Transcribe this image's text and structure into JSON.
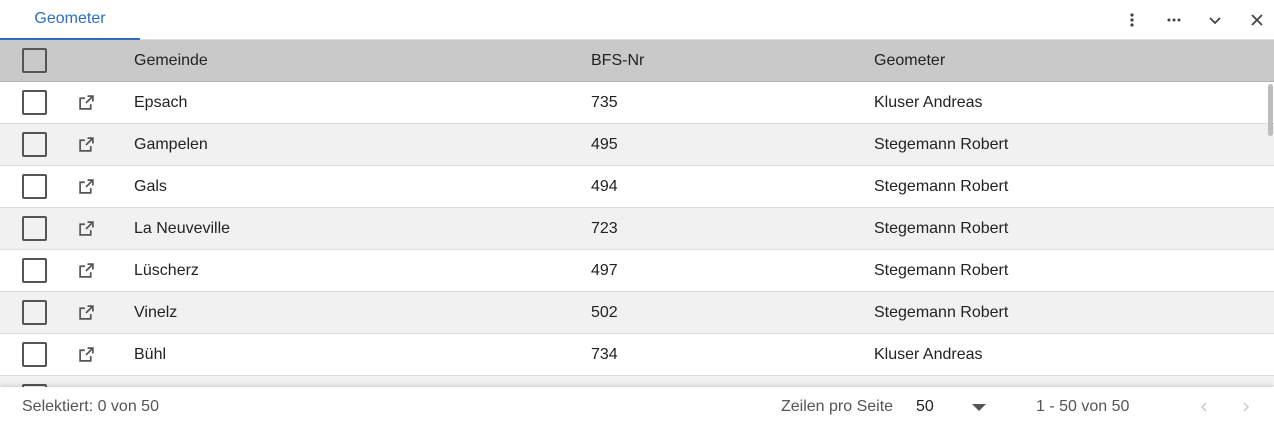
{
  "tab": {
    "label": "Geometer"
  },
  "toolbar": {
    "icons": [
      "more-vertical-icon",
      "more-horizontal-icon",
      "chevron-down-icon",
      "close-icon"
    ]
  },
  "table": {
    "columns": {
      "gemeinde": "Gemeinde",
      "bfs": "BFS-Nr",
      "geometer": "Geometer"
    },
    "rows": [
      {
        "gemeinde": "Epsach",
        "bfs": "735",
        "geometer": "Kluser Andreas"
      },
      {
        "gemeinde": "Gampelen",
        "bfs": "495",
        "geometer": "Stegemann Robert"
      },
      {
        "gemeinde": "Gals",
        "bfs": "494",
        "geometer": "Stegemann Robert"
      },
      {
        "gemeinde": "La Neuveville",
        "bfs": "723",
        "geometer": "Stegemann Robert"
      },
      {
        "gemeinde": "Lüscherz",
        "bfs": "497",
        "geometer": "Stegemann Robert"
      },
      {
        "gemeinde": "Vinelz",
        "bfs": "502",
        "geometer": "Stegemann Robert"
      },
      {
        "gemeinde": "Bühl",
        "bfs": "734",
        "geometer": "Kluser Andreas"
      }
    ]
  },
  "footer": {
    "selected": "Selektiert: 0 von 50",
    "rows_per_page_label": "Zeilen pro Seite",
    "rows_per_page_value": "50",
    "range": "1 - 50 von 50"
  },
  "colors": {
    "accent": "#2d6fbf",
    "header_bg": "#c9c9c9",
    "row_alt_bg": "#f1f1f1"
  }
}
